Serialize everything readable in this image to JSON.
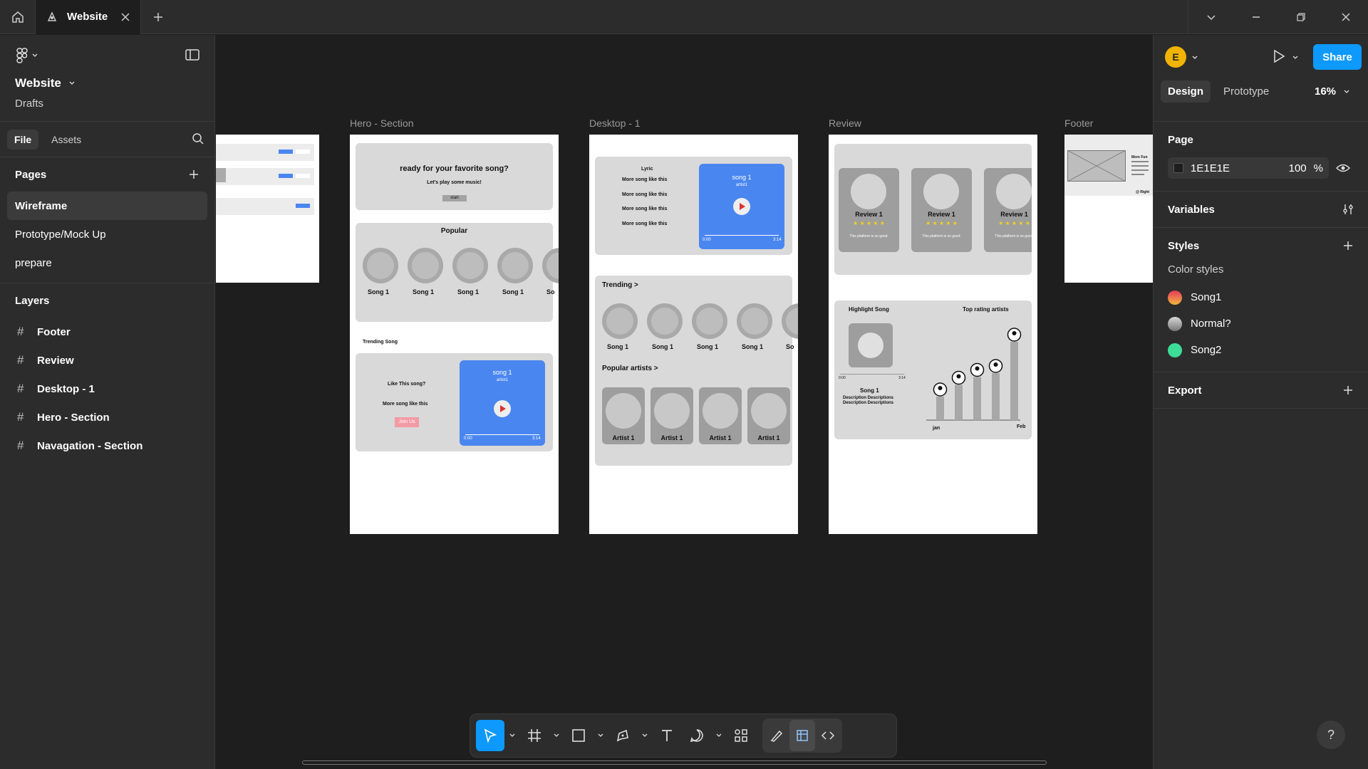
{
  "titlebar": {
    "tab_name": "Website"
  },
  "left": {
    "file_name": "Website",
    "location": "Drafts",
    "tabs": [
      "File",
      "Assets"
    ],
    "pages_heading": "Pages",
    "pages": [
      "Wireframe",
      "Prototype/Mock Up",
      "prepare"
    ],
    "layers_heading": "Layers",
    "layers": [
      "Footer",
      "Review",
      "Desktop - 1",
      "Hero - Section",
      "Navagation - Section"
    ]
  },
  "canvas": {
    "labels": {
      "hero": "Hero - Section",
      "desktop": "Desktop - 1",
      "review": "Review",
      "footer": "Footer"
    },
    "hero": {
      "headline": "ready for your favorite song?",
      "subline": "Let's play some music!",
      "start": "start",
      "popular": "Popular",
      "songs": [
        "Song 1",
        "Song 1",
        "Song 1",
        "Song 1",
        "So"
      ],
      "trending_song": "Trending Song",
      "like": "Like This song?",
      "more": "More song like this",
      "join": "Join Us",
      "player_title": "song 1",
      "player_artist": "artist1",
      "t_start": "0:00",
      "t_end": "3:14"
    },
    "desktop": {
      "lyric": "Lyric",
      "more_lines": [
        "More song like this",
        "More song like this",
        "More song like this",
        "More song like this"
      ],
      "player_title": "song 1",
      "player_artist": "artist1",
      "t_start": "0:00",
      "t_end": "3:14",
      "trending": "Trending  >",
      "songs": [
        "Song 1",
        "Song 1",
        "Song 1",
        "Song 1",
        "So"
      ],
      "popular_artists": "Popular artists  >",
      "artists": [
        "Artist 1",
        "Artist 1",
        "Artist 1",
        "Artist 1"
      ]
    },
    "review": {
      "reviews": [
        "Review 1",
        "Review 1",
        "Review 1"
      ],
      "stars": "★ ★ ★ ★ ★",
      "review_text": "This platform is so good.",
      "highlight": "Highlight Song",
      "top_rating": "Top rating artists",
      "song": "Song 1",
      "desc1": "Description Descriptions",
      "desc2": "Description Descriptions",
      "t_start": "0:00",
      "t_end": "3:14",
      "x_start": "jan",
      "x_end": "Feb",
      "bars": [
        30,
        45,
        55,
        60,
        100
      ]
    },
    "footer": {
      "more_fun": "More Fun",
      "rights": "@ Right"
    }
  },
  "right": {
    "tabs": [
      "Design",
      "Prototype"
    ],
    "zoom": "16%",
    "share": "Share",
    "avatar": "E",
    "page_heading": "Page",
    "page_color": "1E1E1E",
    "page_opacity": "100",
    "percent": "%",
    "variables": "Variables",
    "styles": "Styles",
    "color_styles": "Color styles",
    "colors": [
      {
        "name": "Song1",
        "color": "#e6395a"
      },
      {
        "name": "Normal?",
        "color": "#9a9a9a"
      },
      {
        "name": "Song2",
        "color": "#3ddc97"
      }
    ],
    "export": "Export"
  },
  "help": "?"
}
